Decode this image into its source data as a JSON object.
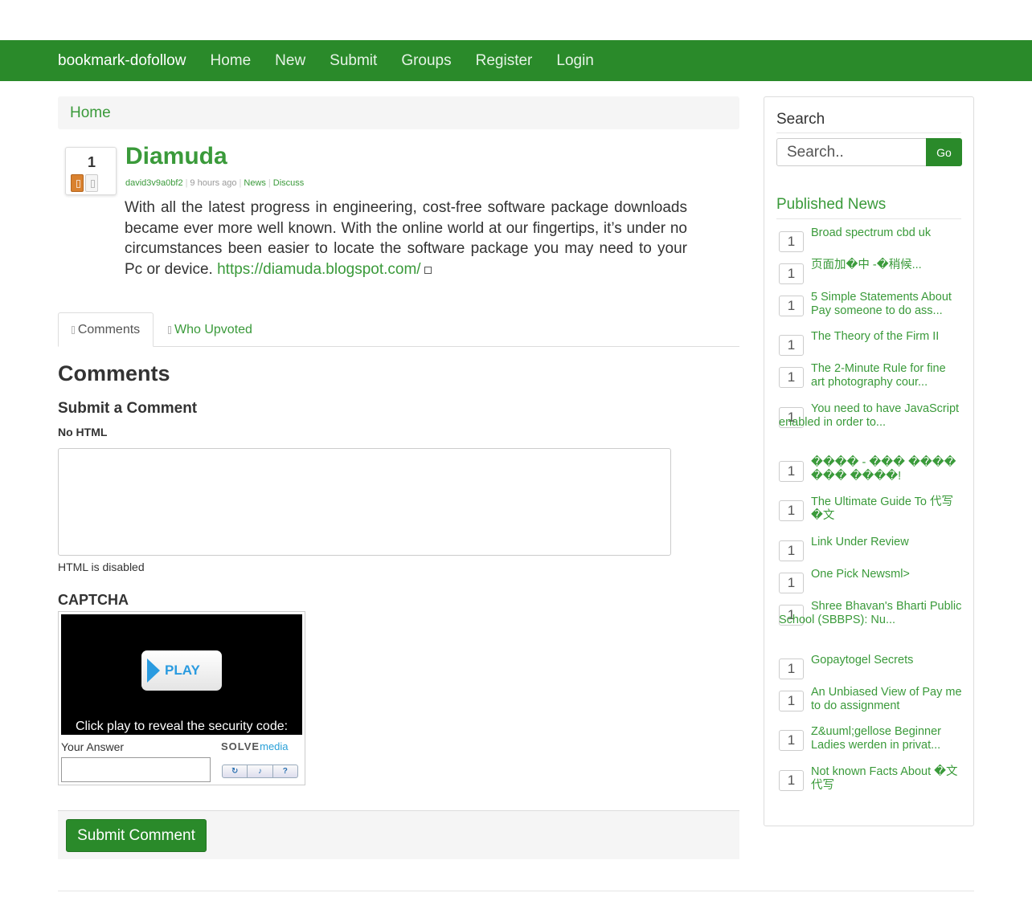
{
  "nav": {
    "brand": "bookmark-dofollow",
    "links": [
      "Home",
      "New",
      "Submit",
      "Groups",
      "Register",
      "Login"
    ]
  },
  "breadcrumb": {
    "home": "Home"
  },
  "story": {
    "votes": "1",
    "title": "Diamuda",
    "author": "david3v9a0bf2",
    "time": "9 hours ago",
    "category": "News",
    "discuss": "Discuss",
    "body": "With all the latest progress in engineering, cost-free software package downloads became ever more well known. With the online world at our fingertips, it’s under no circumstances been easier to locate the software package you may need to your Pc or device.",
    "url": "https://diamuda.blogspot.com/"
  },
  "tabs": {
    "comments": "Comments",
    "who_upvoted": "Who Upvoted"
  },
  "comments_section": {
    "heading": "Comments",
    "submit_heading": "Submit a Comment",
    "no_html": "No HTML",
    "html_disabled": "HTML is disabled",
    "captcha_heading": "CAPTCHA",
    "play_label": "PLAY",
    "captcha_prompt": "Click play to reveal the security code:",
    "your_answer": "Your Answer",
    "solve_logo_1": "SOLVE",
    "solve_logo_2": "media",
    "ctrl_reload": "↻",
    "ctrl_audio": "♪",
    "ctrl_help": "?",
    "submit_button": "Submit Comment"
  },
  "sidebar": {
    "search_title": "Search",
    "search_placeholder": "Search..",
    "go_button": "Go",
    "published_title": "Published News",
    "items": [
      {
        "count": "1",
        "title": "Broad spectrum cbd uk"
      },
      {
        "count": "1",
        "title": "页面加�中 -�稍候..."
      },
      {
        "count": "1",
        "title": "5 Simple Statements About Pay someone to do ass..."
      },
      {
        "count": "1",
        "title": "The Theory of the Firm II"
      },
      {
        "count": "1",
        "title": "The 2-Minute Rule for fine art photography cour..."
      },
      {
        "count": "1",
        "title": "You need to have JavaScript enabled in order to..."
      },
      {
        "count": "1",
        "title": "���� - ��� ���� ��� ����!"
      },
      {
        "count": "1",
        "title": "The Ultimate Guide To 代写�文"
      },
      {
        "count": "1",
        "title": "Link Under Review"
      },
      {
        "count": "1",
        "title": "One Pick Newsml>"
      },
      {
        "count": "1",
        "title": "Shree Bhavan's Bharti Public School (SBBPS): Nu..."
      },
      {
        "count": "1",
        "title": "Gopaytogel Secrets"
      },
      {
        "count": "1",
        "title": "An Unbiased View of Pay me to do assignment"
      },
      {
        "count": "1",
        "title": "Z&uuml;gellose Beginner Ladies werden in privat..."
      },
      {
        "count": "1",
        "title": "Not known Facts About �文代写"
      }
    ]
  }
}
